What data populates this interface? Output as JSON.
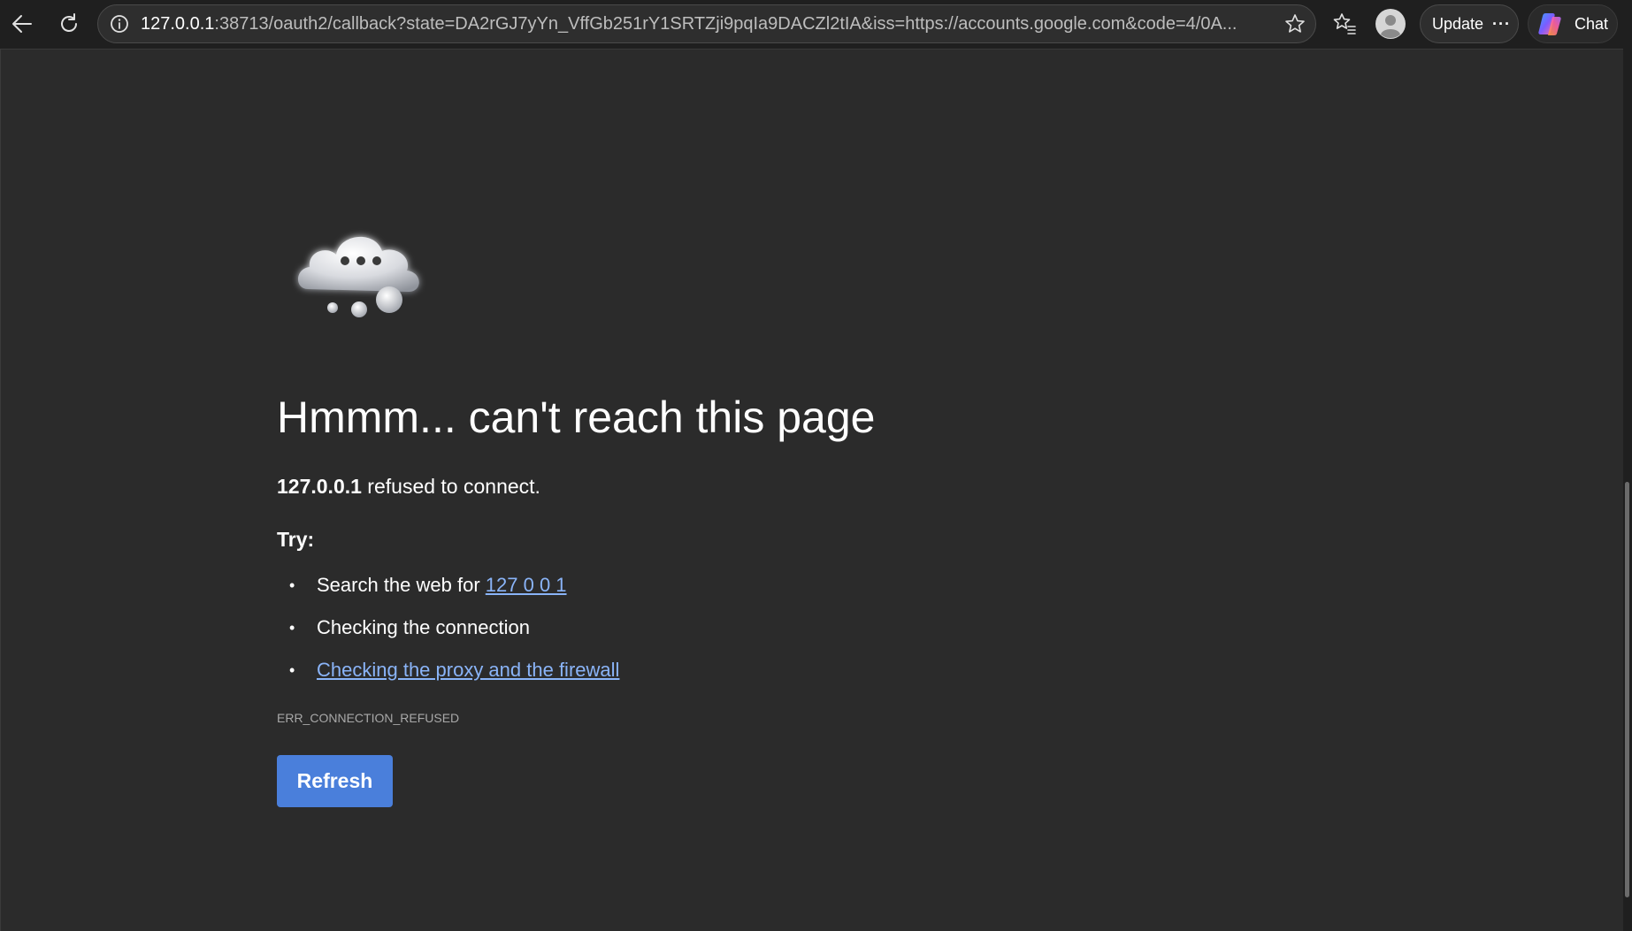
{
  "browser": {
    "address_bar": {
      "url_host": "127.0.0.1",
      "url_rest": ":38713/oauth2/callback?state=DA2rGJ7yYn_VffGb251rY1SRTZji9pqIa9DACZl2tIA&iss=https://accounts.google.com&code=4/0A..."
    },
    "update_label": "Update",
    "more_label": "···",
    "chat_label": "Chat",
    "icons": {
      "back": "back-arrow-icon",
      "refresh": "refresh-icon",
      "info": "info-icon",
      "favorite": "star-icon",
      "favorites": "favorites-icon",
      "profile": "profile-icon",
      "copilot": "copilot-icon"
    }
  },
  "error_page": {
    "title": "Hmmm... can't reach this page",
    "host": "127.0.0.1",
    "message_suffix": " refused to connect.",
    "try_label": "Try:",
    "suggestions": {
      "search_prefix": "Search the web for ",
      "search_link": "127 0 0 1",
      "connection": "Checking the connection",
      "proxy_link": "Checking the proxy and the firewall"
    },
    "error_code": "ERR_CONNECTION_REFUSED",
    "refresh_label": "Refresh"
  },
  "colors": {
    "background": "#2b2b2b",
    "toolbar": "#1f1f1f",
    "link": "#8ab4f8",
    "button": "#4a7fdb"
  }
}
